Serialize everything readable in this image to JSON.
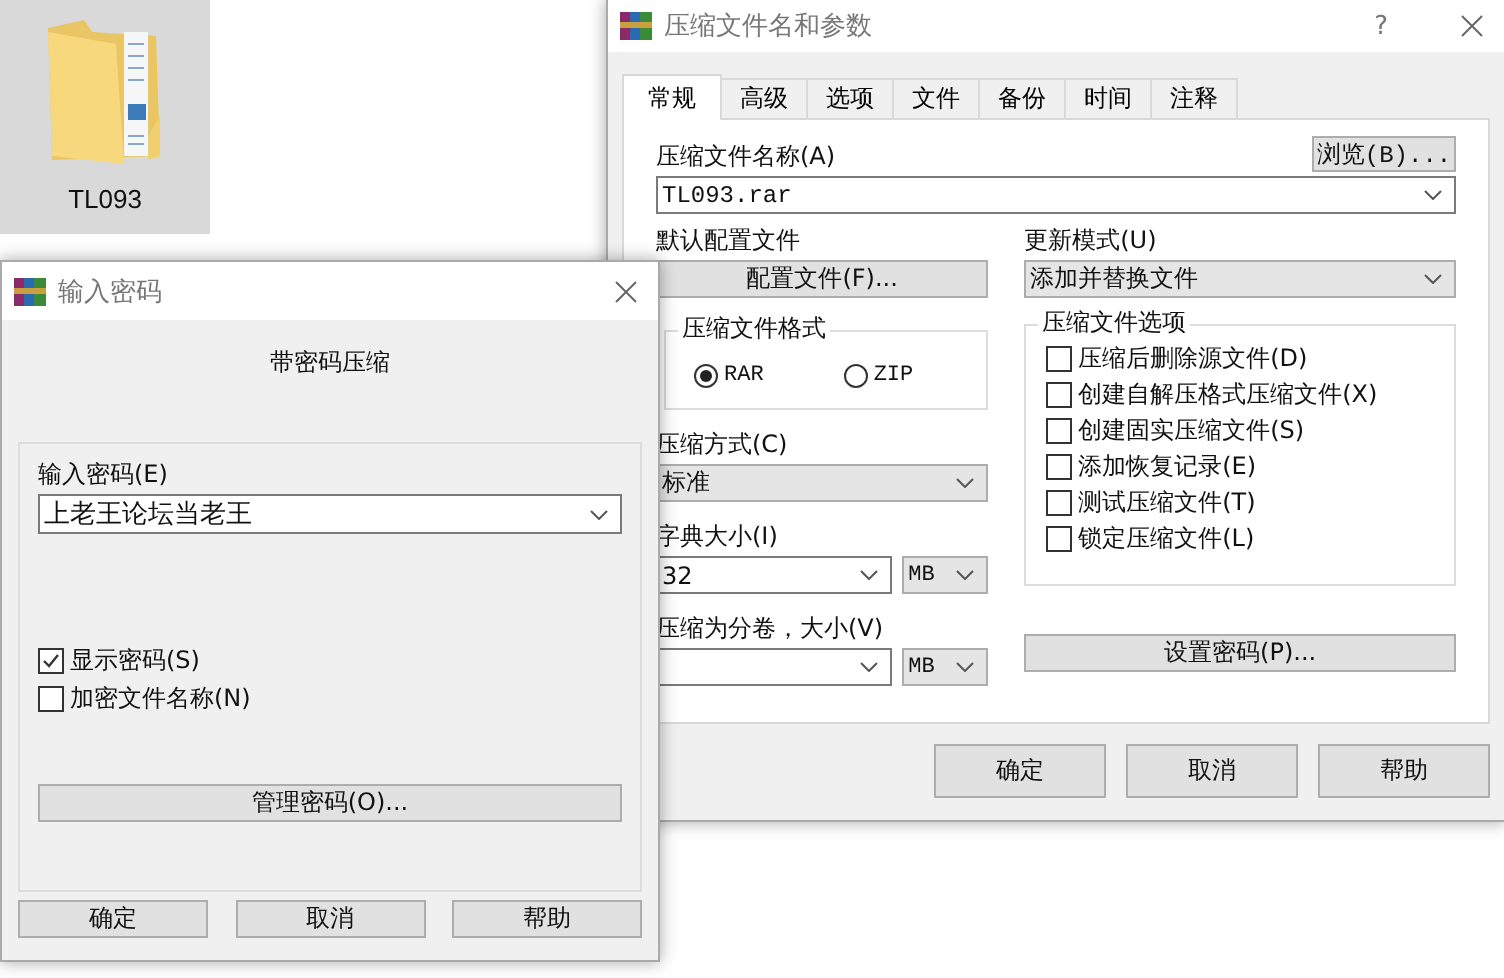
{
  "desktop_item": {
    "label": "TL093",
    "selected": true
  },
  "archive_dialog": {
    "title": "压缩文件名和参数",
    "help": "?",
    "tabs": [
      {
        "label": "常规",
        "selected": true
      },
      {
        "label": "高级",
        "selected": false
      },
      {
        "label": "选项",
        "selected": false
      },
      {
        "label": "文件",
        "selected": false
      },
      {
        "label": "备份",
        "selected": false
      },
      {
        "label": "时间",
        "selected": false
      },
      {
        "label": "注释",
        "selected": false
      }
    ],
    "archive_name": {
      "label": "压缩文件名称(A)",
      "value": "TL093.rar"
    },
    "browse_button": "浏览(B)...",
    "profile": {
      "label": "默认配置文件",
      "button": "配置文件(F)..."
    },
    "update_mode": {
      "label": "更新模式(U)",
      "value": "添加并替换文件"
    },
    "format": {
      "title": "压缩文件格式",
      "options": [
        {
          "label": "RAR",
          "selected": true
        },
        {
          "label": "ZIP",
          "selected": false
        }
      ]
    },
    "options": {
      "title": "压缩文件选项",
      "items": [
        {
          "label": "压缩后删除源文件(D)",
          "checked": false
        },
        {
          "label": "创建自解压格式压缩文件(X)",
          "checked": false
        },
        {
          "label": "创建固实压缩文件(S)",
          "checked": false
        },
        {
          "label": "添加恢复记录(E)",
          "checked": false
        },
        {
          "label": "测试压缩文件(T)",
          "checked": false
        },
        {
          "label": "锁定压缩文件(L)",
          "checked": false
        }
      ]
    },
    "method": {
      "label": "压缩方式(C)",
      "value": "标准"
    },
    "dictionary": {
      "label": "字典大小(I)",
      "value": "32",
      "unit": "MB"
    },
    "volume": {
      "label": "压缩为分卷，大小(V)",
      "unit": "MB"
    },
    "set_password_button": "设置密码(P)...",
    "buttons": [
      "确定",
      "取消",
      "帮助"
    ]
  },
  "password_dialog": {
    "title": "输入密码",
    "heading": "带密码压缩",
    "password": {
      "label": "输入密码(E)",
      "value": "上老王论坛当老王"
    },
    "checkboxes": [
      {
        "label": "显示密码(S)",
        "checked": true
      },
      {
        "label": "加密文件名称(N)",
        "checked": false
      }
    ],
    "manage_button": "管理密码(O)...",
    "buttons": [
      "确定",
      "取消",
      "帮助"
    ]
  }
}
